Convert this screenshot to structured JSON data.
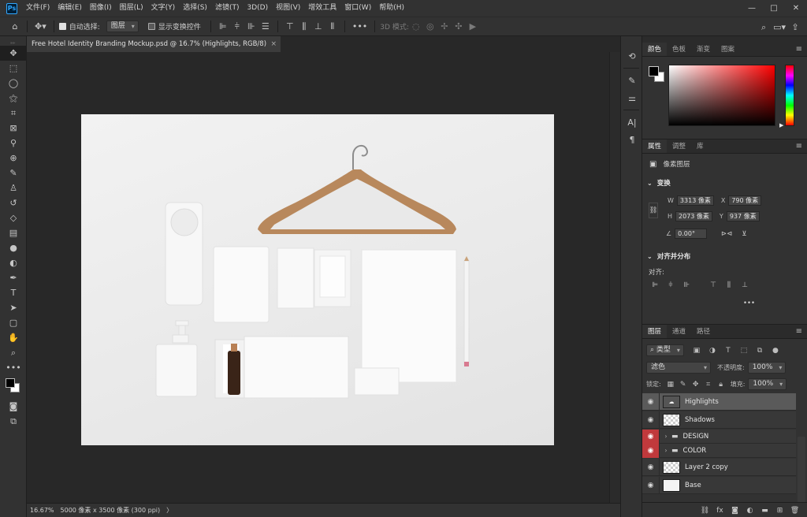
{
  "app": {
    "logo": "Ps"
  },
  "menu": [
    "文件(F)",
    "编辑(E)",
    "图像(I)",
    "图层(L)",
    "文字(Y)",
    "选择(S)",
    "滤镜(T)",
    "3D(D)",
    "视图(V)",
    "增效工具",
    "窗口(W)",
    "帮助(H)"
  ],
  "window": {
    "minimize": "—",
    "maximize": "□",
    "close": "✕"
  },
  "options": {
    "auto_select_label": "自动选择:",
    "auto_select_value": "图层",
    "show_transform_label": "显示变换控件",
    "mode_3d_label": "3D 模式:"
  },
  "document": {
    "tab_title": "Free Hotel Identity Branding Mockup.psd @ 16.7% (Highlights, RGB/8)",
    "zoom": "16.67%",
    "dimensions": "5000 像素 x 3500 像素 (300 ppi)"
  },
  "panels": {
    "color_tabs": [
      "颜色",
      "色板",
      "渐变",
      "图案"
    ],
    "props_tabs": [
      "属性",
      "调整",
      "库"
    ],
    "layers_tabs": [
      "图层",
      "通道",
      "路径"
    ]
  },
  "properties": {
    "layer_type": "像素图层",
    "transform_title": "变换",
    "w_label": "W",
    "w_value": "3313 像素",
    "h_label": "H",
    "h_value": "2073 像素",
    "x_label": "X",
    "x_value": "790 像素",
    "y_label": "Y",
    "y_value": "937 像素",
    "angle_value": "0.00°",
    "align_title": "对齐并分布",
    "align_label": "对齐:"
  },
  "layers": {
    "filter_kind": "类型",
    "blend_mode": "滤色",
    "opacity_label": "不透明度:",
    "opacity_value": "100%",
    "lock_label": "锁定:",
    "fill_label": "填充:",
    "fill_value": "100%",
    "items": [
      {
        "name": "Highlights",
        "kind": "pixel",
        "selected": true,
        "eye_red": false
      },
      {
        "name": "Shadows",
        "kind": "pixel",
        "selected": false,
        "eye_red": false
      },
      {
        "name": "DESIGN",
        "kind": "group",
        "selected": false,
        "eye_red": true
      },
      {
        "name": "COLOR",
        "kind": "group",
        "selected": false,
        "eye_red": true
      },
      {
        "name": "Layer 2 copy",
        "kind": "pixel",
        "selected": false,
        "eye_red": false
      },
      {
        "name": "Base",
        "kind": "pixel",
        "selected": false,
        "eye_red": false
      }
    ]
  },
  "icons": {
    "home": "home-icon",
    "move": "move-icon",
    "search": "search-icon",
    "share": "share-icon",
    "eye": "eye-icon",
    "folder": "folder-icon",
    "trash": "trash-icon"
  }
}
